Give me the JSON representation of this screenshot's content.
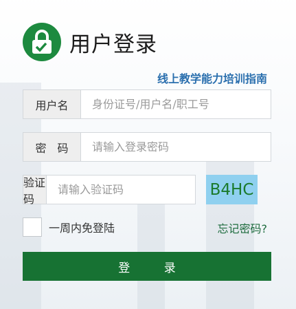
{
  "header": {
    "logo_icon": "lock-check-icon",
    "title": "用户登录"
  },
  "guide_link": "线上教学能力培训指南",
  "form": {
    "username": {
      "label": "用户名",
      "placeholder": "身份证号/用户名/职工号"
    },
    "password": {
      "label": "密　码",
      "placeholder": "请输入登录密码"
    },
    "captcha": {
      "label": "验证码",
      "placeholder": "请输入验证码",
      "code": "B4HC"
    },
    "remember_label": "一周内免登陆",
    "forgot_link": "忘记密码?",
    "login_button": "登 录"
  },
  "colors": {
    "brand_green": "#177233",
    "link_blue": "#2a6fae",
    "captcha_bg": "#8fd0ef"
  }
}
